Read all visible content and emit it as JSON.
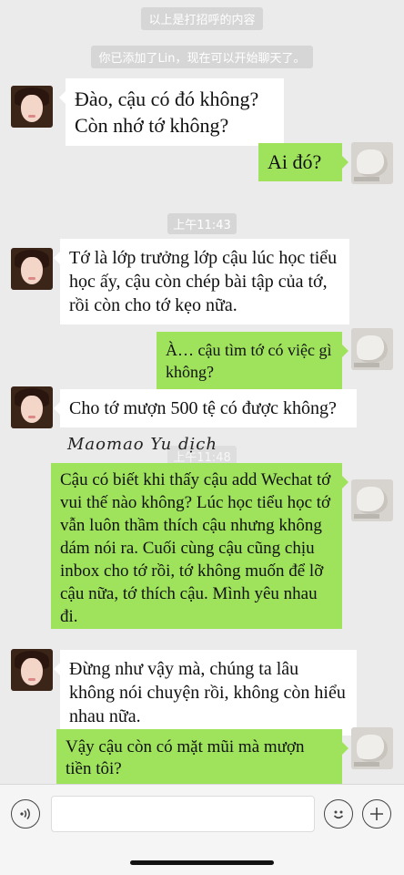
{
  "system_messages": {
    "greeting_notice": "以上是打招呼的内容",
    "added_notice": "你已添加了Lin，现在可以开始聊天了。"
  },
  "timestamps": {
    "t1": "上午11:43",
    "t2": "上午11:48"
  },
  "messages": [
    {
      "side": "left",
      "text": "Đào, cậu có đó không?\nCòn nhớ tớ không?"
    },
    {
      "side": "right",
      "text": "Ai đó?"
    },
    {
      "side": "left",
      "text": "Tớ là lớp trưởng lớp cậu lúc học tiểu học ấy, cậu còn chép bài tập của tớ, rồi còn cho tớ kẹo nữa."
    },
    {
      "side": "right",
      "text": "À… cậu tìm tớ có việc gì không?"
    },
    {
      "side": "left",
      "text": "Cho tớ mượn 500 tệ có được không?"
    },
    {
      "side": "right",
      "text": "Cậu có biết khi thấy cậu add Wechat tớ vui thế nào không? Lúc học tiểu học tớ vẫn luôn thầm thích cậu nhưng không dám nói ra. Cuối cùng cậu cũng chịu inbox cho tớ rồi, tớ không muốn để lỡ cậu nữa, tớ thích cậu. Mình yêu nhau đi."
    },
    {
      "side": "left",
      "text": "Đừng như vậy mà, chúng ta lâu không nói chuyện rồi, không còn hiểu nhau nữa."
    },
    {
      "side": "right",
      "text": "Vậy cậu còn có mặt mũi mà mượn tiền tôi?"
    }
  ],
  "watermark": "Maomao Yu dịch",
  "input_bar": {
    "voice_icon": "voice-icon",
    "emoji_icon": "emoji-icon",
    "add_icon": "plus-icon",
    "input_value": ""
  },
  "colors": {
    "background": "#ebebeb",
    "bubble_left": "#ffffff",
    "bubble_right": "#9fe35c",
    "system_chip": "#d6d6d6"
  }
}
